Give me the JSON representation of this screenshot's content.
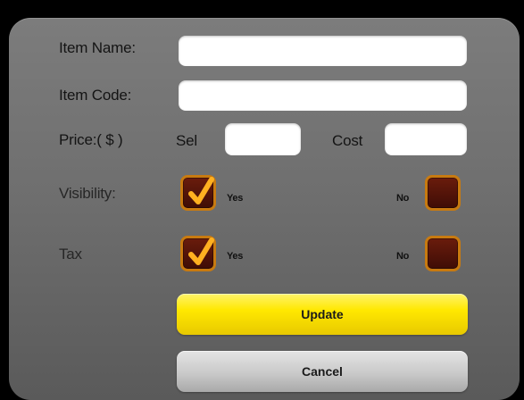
{
  "form": {
    "item_name_label": "Item Name:",
    "item_name_value": "",
    "item_code_label": "Item Code:",
    "item_code_value": "",
    "price_label": "Price:( $ )",
    "sell_label": "Sel",
    "sell_value": "",
    "cost_label": "Cost",
    "cost_value": "",
    "visibility": {
      "label": "Visibility:",
      "yes_label": "Yes",
      "no_label": "No",
      "yes_checked": true,
      "no_checked": false
    },
    "tax": {
      "label": "Tax",
      "yes_label": "Yes",
      "no_label": "No",
      "yes_checked": true,
      "no_checked": false
    }
  },
  "buttons": {
    "update_label": "Update",
    "cancel_label": "Cancel"
  },
  "colors": {
    "accent_yellow": "#ffe800",
    "checkbox_border": "#c87a10",
    "checkmark": "#ffb020"
  },
  "icons": {
    "check": "checkmark-icon"
  }
}
